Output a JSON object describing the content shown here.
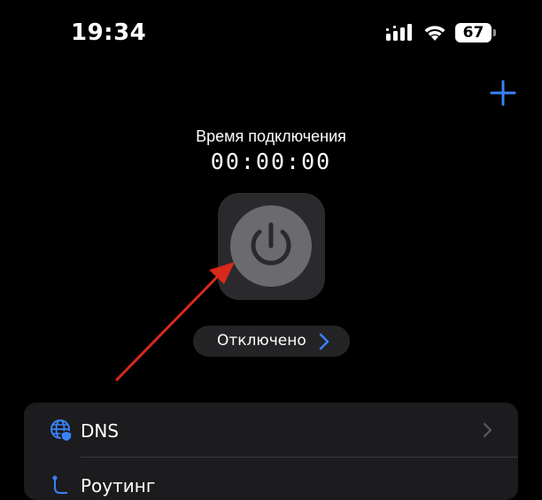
{
  "status_bar": {
    "time": "19:34",
    "battery": "67",
    "icons": [
      "cellular-signal-icon",
      "wifi-icon",
      "battery-icon"
    ]
  },
  "header": {
    "add_icon": "plus-icon",
    "accent_color": "#3a82f7"
  },
  "connection": {
    "timer_label": "Время подключения",
    "timer_value": "00:00:00",
    "power_icon": "power-icon",
    "status_text": "Отключено",
    "status_chevron_color": "#3a82f7"
  },
  "annotation": {
    "arrow_color": "#d9291c"
  },
  "settings": {
    "items": [
      {
        "label": "DNS",
        "icon": "globe-shield-icon"
      },
      {
        "label": "Роутинг",
        "icon": "routing-icon"
      }
    ]
  }
}
